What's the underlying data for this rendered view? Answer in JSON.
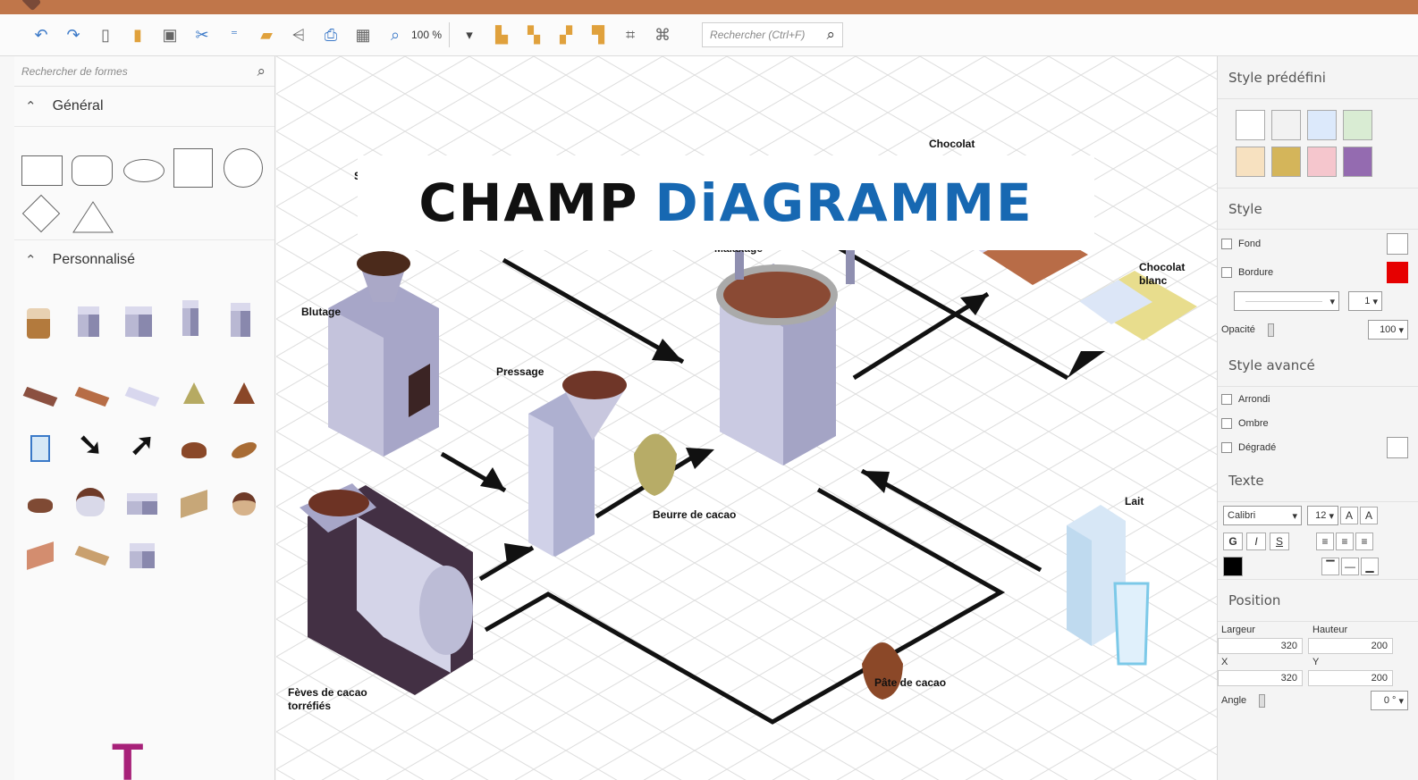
{
  "toolbar": {
    "zoom": "100 %",
    "search_placeholder": "Rechercher (Ctrl+F)"
  },
  "left_panel": {
    "search_placeholder": "Rechercher de formes",
    "section_general": "Général",
    "section_custom": "Personnalisé"
  },
  "banner": {
    "word1": "CHAMP",
    "word2": "DiAGRAMME"
  },
  "diagram": {
    "labels": {
      "blutage": "Blutage",
      "pressage": "Pressage",
      "chocolat": "Chocolat",
      "chocolat_blanc": "Chocolat blanc",
      "beurre": "Beurre de cacao",
      "lait": "Lait",
      "pate": "Pâte de cacao",
      "feves": "Fèves de cacao torréfiés",
      "malaxage": "Malaxage",
      "hidden_s": "S"
    }
  },
  "right_panel": {
    "preset_style": "Style prédéfini",
    "style": "Style",
    "fond": "Fond",
    "bordure": "Bordure",
    "line_width": "1",
    "opacity_label": "Opacité",
    "opacity_value": "100",
    "advanced_style": "Style avancé",
    "arrondi": "Arrondi",
    "ombre": "Ombre",
    "degrade": "Dégradé",
    "text": "Texte",
    "font": "Calibri",
    "font_size": "12",
    "bold": "G",
    "italic": "I",
    "strike": "S",
    "position": "Position",
    "width_label": "Largeur",
    "height_label": "Hauteur",
    "width_value": "320",
    "height_value": "200",
    "x_label": "X",
    "y_label": "Y",
    "x_value": "320",
    "y_value": "200",
    "angle_label": "Angle",
    "angle_value": "0 °"
  },
  "colors": {
    "accent_blue": "#1768b2",
    "border_red": "#e60000",
    "brand_brown": "#c0764a",
    "magenta_mark": "#a72179"
  }
}
